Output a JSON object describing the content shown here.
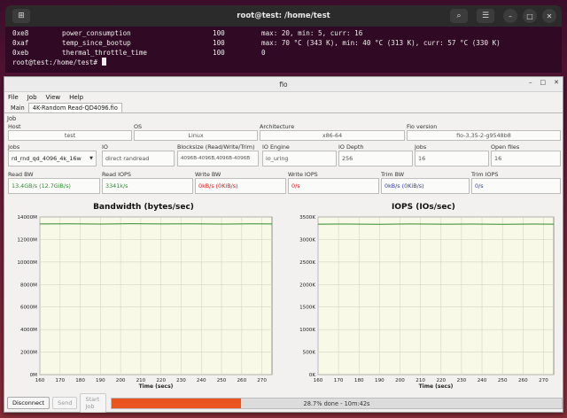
{
  "terminal": {
    "title": "root@test: /home/test",
    "rows": [
      {
        "id": "0xe8",
        "name": "power_consumption",
        "val": "100",
        "info": "max: 20, min: 5, curr: 16"
      },
      {
        "id": "0xaf",
        "name": "temp_since_bootup",
        "val": "100",
        "info": "max: 70 °C (343 K), min: 40 °C (313 K), curr: 57 °C (330 K)"
      },
      {
        "id": "0xeb",
        "name": "thermal_throttle_time",
        "val": "100",
        "info": "0"
      }
    ],
    "prompt": "root@test:/home/test# "
  },
  "fio": {
    "title": "fio",
    "menu": [
      "File",
      "Job",
      "View",
      "Help"
    ],
    "tabs": [
      "Main",
      "4K-Random Read-QD4096.fio"
    ],
    "job_label": "Job",
    "host": {
      "label": "Host",
      "value": "test"
    },
    "os": {
      "label": "OS",
      "value": "Linux"
    },
    "arch": {
      "label": "Architecture",
      "value": "x86-64"
    },
    "fio_version": {
      "label": "Fio version",
      "value": "fio-3.35-2-g9548b8"
    },
    "jobs_select": {
      "label": "Jobs",
      "value": "rd_rnd_qd_4096_4k_16w"
    },
    "io": {
      "label": "IO",
      "value": "direct randread"
    },
    "blocksize": {
      "label": "Blocksize (Read/Write/Trim)",
      "value": "4096B-4096B,4096B-4096B"
    },
    "io_engine": {
      "label": "IO Engine",
      "value": "io_uring"
    },
    "io_depth": {
      "label": "IO Depth",
      "value": "256"
    },
    "jobs_count": {
      "label": "Jobs",
      "value": "16"
    },
    "open_files": {
      "label": "Open files",
      "value": "16"
    },
    "read_bw": {
      "label": "Read BW",
      "value": "13.4GB/s (12.7GiB/s)"
    },
    "read_iops": {
      "label": "Read IOPS",
      "value": "3341k/s"
    },
    "write_bw": {
      "label": "Write BW",
      "value": "0kB/s (0KiB/s)"
    },
    "write_iops": {
      "label": "Write IOPS",
      "value": "0/s"
    },
    "trim_bw": {
      "label": "Trim BW",
      "value": "0kB/s (0KiB/s)"
    },
    "trim_iops": {
      "label": "Trim IOPS",
      "value": "0/s"
    },
    "buttons": {
      "disconnect": "Disconnect",
      "send": "Send",
      "start": "Start Job"
    },
    "progress": {
      "fraction": 0.287,
      "text": "28.7% done - 10m:42s"
    }
  },
  "chart_data": [
    {
      "type": "line",
      "title": "Bandwidth (bytes/sec)",
      "xlabel": "Time (secs)",
      "ylabel": "",
      "xlim": [
        160,
        275
      ],
      "ylim": [
        0,
        14000
      ],
      "xticks": [
        160,
        170,
        180,
        190,
        200,
        210,
        220,
        230,
        240,
        250,
        260,
        270
      ],
      "yticks": [
        0,
        2000,
        4000,
        6000,
        8000,
        10000,
        12000,
        14000
      ],
      "ytick_labels": [
        "0M",
        "2000M",
        "4000M",
        "6000M",
        "8000M",
        "10000M",
        "12000M",
        "14000M"
      ],
      "grid": true,
      "series": [
        {
          "color": "#2e8b2e",
          "x": [
            160,
            175,
            190,
            205,
            220,
            235,
            250,
            265,
            275
          ],
          "y": [
            13380,
            13390,
            13370,
            13400,
            13380,
            13390,
            13370,
            13390,
            13385
          ]
        }
      ]
    },
    {
      "type": "line",
      "title": "IOPS (IOs/sec)",
      "xlabel": "Time (secs)",
      "ylabel": "",
      "xlim": [
        160,
        275
      ],
      "ylim": [
        0,
        3500
      ],
      "xticks": [
        160,
        170,
        180,
        190,
        200,
        210,
        220,
        230,
        240,
        250,
        260,
        270
      ],
      "yticks": [
        0,
        500,
        1000,
        1500,
        2000,
        2500,
        3000,
        3500
      ],
      "ytick_labels": [
        "0K",
        "500K",
        "1000K",
        "1500K",
        "2000K",
        "2500K",
        "3000K",
        "3500K"
      ],
      "grid": true,
      "series": [
        {
          "color": "#2e8b2e",
          "x": [
            160,
            175,
            190,
            205,
            220,
            235,
            250,
            265,
            275
          ],
          "y": [
            3341,
            3343,
            3338,
            3345,
            3340,
            3342,
            3339,
            3343,
            3341
          ]
        }
      ]
    }
  ]
}
